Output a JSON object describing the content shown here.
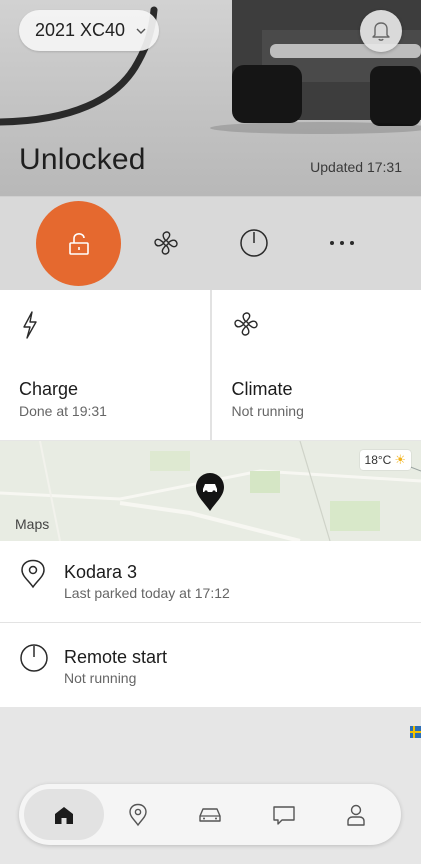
{
  "header": {
    "model": "2021 XC40",
    "status": "Unlocked",
    "updated": "Updated 17:31"
  },
  "actions": [
    {
      "name": "lock",
      "icon": "unlocked-padlock-icon",
      "active": true
    },
    {
      "name": "climate",
      "icon": "fan-icon"
    },
    {
      "name": "engine",
      "icon": "power-icon"
    },
    {
      "name": "more",
      "icon": "more-dots-icon"
    }
  ],
  "cards": {
    "charge": {
      "title": "Charge",
      "subtitle": "Done at 19:31",
      "icon": "lightning-icon"
    },
    "climate": {
      "title": "Climate",
      "subtitle": "Not running",
      "icon": "fan-icon"
    }
  },
  "map": {
    "weather": "18°C",
    "maps_label": "Maps"
  },
  "location": {
    "title": "Kodara 3",
    "subtitle": "Last parked today at 17:12",
    "icon": "location-pin-icon"
  },
  "remote_start": {
    "title": "Remote start",
    "subtitle": "Not running",
    "icon": "power-icon"
  },
  "nav": [
    {
      "name": "home",
      "icon": "home-icon",
      "active": true
    },
    {
      "name": "map",
      "icon": "map-pin-icon"
    },
    {
      "name": "car",
      "icon": "car-icon"
    },
    {
      "name": "messages",
      "icon": "chat-icon"
    },
    {
      "name": "profile",
      "icon": "profile-icon"
    }
  ],
  "colors": {
    "accent": "#e5692f",
    "background": "#e6e6e6",
    "card": "#ffffff"
  }
}
